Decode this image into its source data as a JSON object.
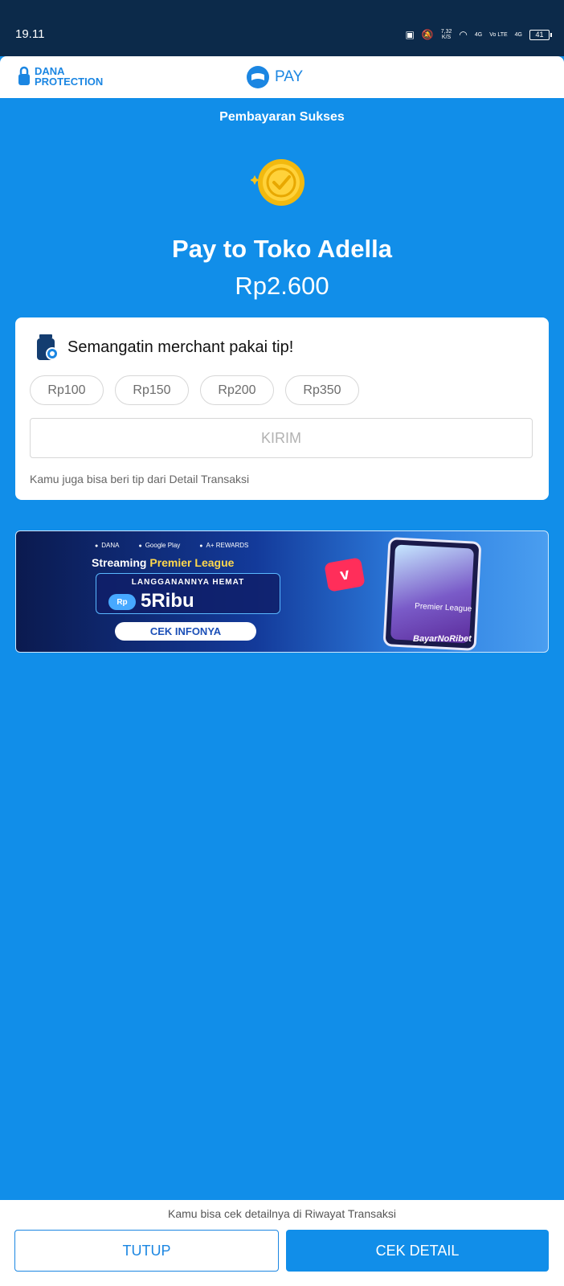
{
  "status_bar": {
    "time": "19.11",
    "speed_value": "7,32",
    "speed_unit": "K/S",
    "network_1": "4G",
    "network_2": "Vo LTE",
    "network_3": "4G",
    "battery": "41"
  },
  "header": {
    "protection_label": "DANA PROTECTION",
    "pay_label": "PAY"
  },
  "payment": {
    "status": "Pembayaran Sukses",
    "merchant": "Pay to Toko Adella",
    "amount": "Rp2.600"
  },
  "tip": {
    "title": "Semangatin merchant pakai tip!",
    "options": [
      "Rp100",
      "Rp150",
      "Rp200",
      "Rp350"
    ],
    "send_label": "KIRIM",
    "note": "Kamu juga bisa beri tip dari Detail Transaksi"
  },
  "banner": {
    "brands": [
      "DANA",
      "Google Play",
      "A+ REWARDS"
    ],
    "headline_lead": "Streaming ",
    "headline_highlight": "Premier League",
    "subtitle": "LANGGANANNYA HEMAT",
    "currency_badge": "Rp",
    "price": "5Ribu",
    "cta": "CEK INFONYA",
    "league_text": "Premier League",
    "tag": "BayarNoRibet"
  },
  "footer": {
    "history_note": "Kamu bisa cek detailnya di Riwayat Transaksi",
    "close_label": "TUTUP",
    "detail_label": "CEK DETAIL"
  },
  "colors": {
    "primary_blue": "#118ee9",
    "status_bar": "#0c2a4a",
    "coin_gold": "#f6c31b"
  }
}
